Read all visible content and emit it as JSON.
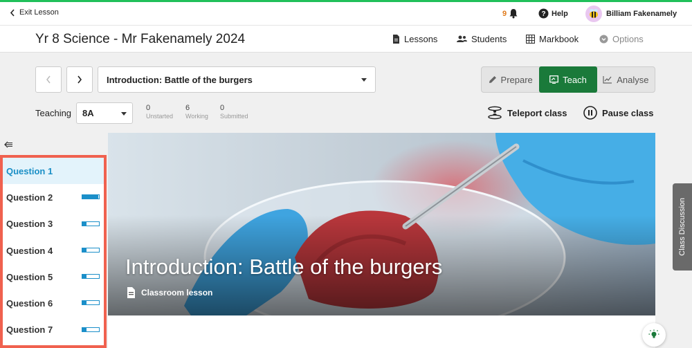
{
  "topbar": {
    "exit_label": "Exit Lesson",
    "notification_count": "9",
    "help_label": "Help",
    "user_name": "Billiam Fakenamely"
  },
  "header": {
    "course_title": "Yr 8 Science - Mr Fakenamely 2024",
    "nav": {
      "lessons": "Lessons",
      "students": "Students",
      "markbook": "Markbook",
      "options": "Options"
    }
  },
  "lesson_select": {
    "value": "Introduction: Battle of the burgers"
  },
  "mode_tabs": {
    "prepare": "Prepare",
    "teach": "Teach",
    "analyse": "Analyse",
    "active": "Teach"
  },
  "teaching": {
    "label": "Teaching",
    "class_value": "8A",
    "stats": [
      {
        "count": "0",
        "label": "Unstarted"
      },
      {
        "count": "6",
        "label": "Working"
      },
      {
        "count": "0",
        "label": "Submitted"
      }
    ]
  },
  "actions": {
    "teleport": "Teleport class",
    "pause": "Pause class"
  },
  "questions": [
    {
      "label": "Question 1",
      "progress": null
    },
    {
      "label": "Question 2",
      "progress": 0.95
    },
    {
      "label": "Question 3",
      "progress": 0.25
    },
    {
      "label": "Question 4",
      "progress": 0.25
    },
    {
      "label": "Question 5",
      "progress": 0.25
    },
    {
      "label": "Question 6",
      "progress": 0.25
    },
    {
      "label": "Question 7",
      "progress": 0.25
    }
  ],
  "hero": {
    "title": "Introduction: Battle of the burgers",
    "subtitle": "Classroom lesson"
  },
  "side_panel": {
    "label": "Class Discussion"
  },
  "colors": {
    "accent_green": "#1a7a3a",
    "accent_blue": "#1b8fc9",
    "highlight_red": "#f0614f",
    "top_border": "#20c05a"
  }
}
